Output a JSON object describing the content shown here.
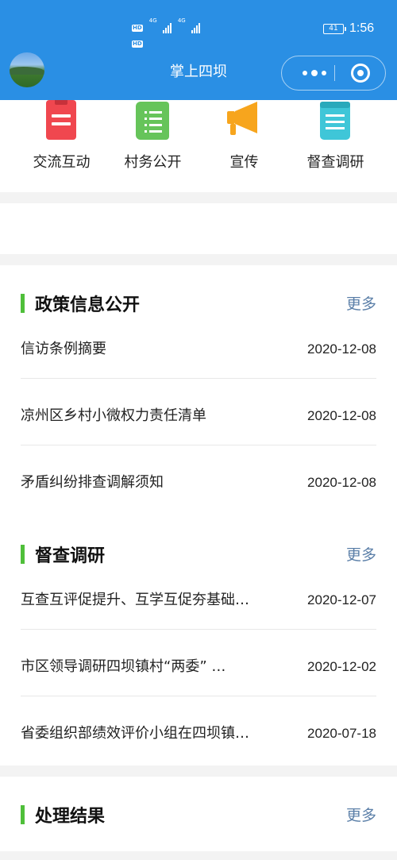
{
  "status_bar": {
    "hd1": "HD",
    "hd2": "HD",
    "net1": "4G",
    "net2": "4G",
    "battery": "41",
    "time": "1:56"
  },
  "app_bar": {
    "title": "掌上四坝"
  },
  "quick_nav": [
    {
      "label": "交流互动",
      "icon": "clipboard-icon",
      "color": "#f0474f"
    },
    {
      "label": "村务公开",
      "icon": "document-list-icon",
      "color": "#66c45a"
    },
    {
      "label": "宣传",
      "icon": "megaphone-icon",
      "color": "#f7a51d"
    },
    {
      "label": "督查调研",
      "icon": "notepad-icon",
      "color": "#3fc6d8"
    }
  ],
  "sections": [
    {
      "title": "政策信息公开",
      "more": "更多",
      "items": [
        {
          "title": "信访条例摘要",
          "date": "2020-12-08"
        },
        {
          "title": "凉州区乡村小微权力责任清单",
          "date": "2020-12-08"
        },
        {
          "title": "矛盾纠纷排查调解须知",
          "date": "2020-12-08"
        }
      ]
    },
    {
      "title": "督查调研",
      "more": "更多",
      "items": [
        {
          "title": "互查互评促提升、互学互促夯基础…",
          "date": "2020-12-07"
        },
        {
          "title": "市区领导调研四坝镇村“两委” …",
          "date": "2020-12-02"
        },
        {
          "title": "省委组织部绩效评价小组在四坝镇…",
          "date": "2020-07-18"
        }
      ]
    },
    {
      "title": "处理结果",
      "more": "更多",
      "items": []
    }
  ],
  "colors": {
    "header": "#2a8fe4",
    "accent_bar": "#4fbf3a",
    "more_link": "#5b7fa8"
  }
}
